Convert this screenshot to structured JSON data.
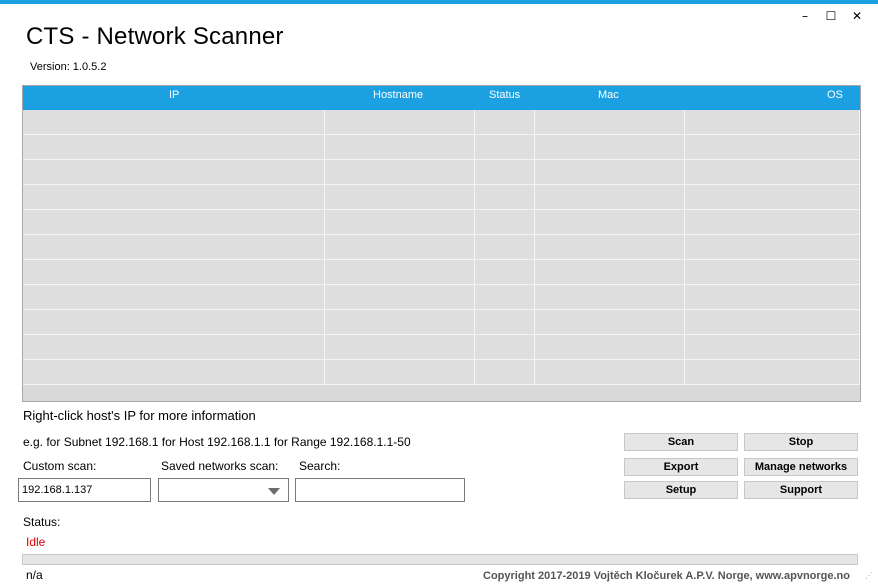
{
  "window": {
    "minimize_glyph": "–",
    "maximize_glyph": "☐",
    "close_glyph": "✕"
  },
  "app": {
    "title": "CTS - Network Scanner",
    "version": "Version: 1.0.5.2"
  },
  "grid": {
    "columns": [
      "IP",
      "Hostname",
      "Status",
      "Mac",
      "OS"
    ],
    "rows": [
      [
        "",
        "",
        "",
        "",
        ""
      ],
      [
        "",
        "",
        "",
        "",
        ""
      ],
      [
        "",
        "",
        "",
        "",
        ""
      ],
      [
        "",
        "",
        "",
        "",
        ""
      ],
      [
        "",
        "",
        "",
        "",
        ""
      ],
      [
        "",
        "",
        "",
        "",
        ""
      ],
      [
        "",
        "",
        "",
        "",
        ""
      ],
      [
        "",
        "",
        "",
        "",
        ""
      ],
      [
        "",
        "",
        "",
        "",
        ""
      ],
      [
        "",
        "",
        "",
        "",
        ""
      ],
      [
        "",
        "",
        "",
        "",
        ""
      ]
    ]
  },
  "hints": {
    "right_click": "Right-click host's IP for more information",
    "example": "e.g. for Subnet 192.168.1 for Host 192.168.1.1 for Range 192.168.1.1-50"
  },
  "form": {
    "custom_scan_label": "Custom scan:",
    "custom_scan_value": "192.168.1.137",
    "saved_networks_label": "Saved networks scan:",
    "saved_networks_value": "",
    "search_label": "Search:",
    "search_value": ""
  },
  "buttons": {
    "scan": "Scan",
    "stop": "Stop",
    "export": "Export",
    "manage_networks": "Manage networks",
    "setup": "Setup",
    "support": "Support"
  },
  "status": {
    "label": "Status:",
    "value": "Idle",
    "progress_fraction": 0
  },
  "footer": {
    "left_text": "n/a",
    "copyright": "Copyright 2017-2019 Vojtěch Kločurek  A.P.V. Norge, www.apvnorge.no"
  },
  "colors": {
    "accent": "#1ba1e2",
    "status_idle": "#e00000"
  },
  "icons": {
    "dropdown": "chevron-down-icon",
    "resize": "resize-grip-icon"
  }
}
